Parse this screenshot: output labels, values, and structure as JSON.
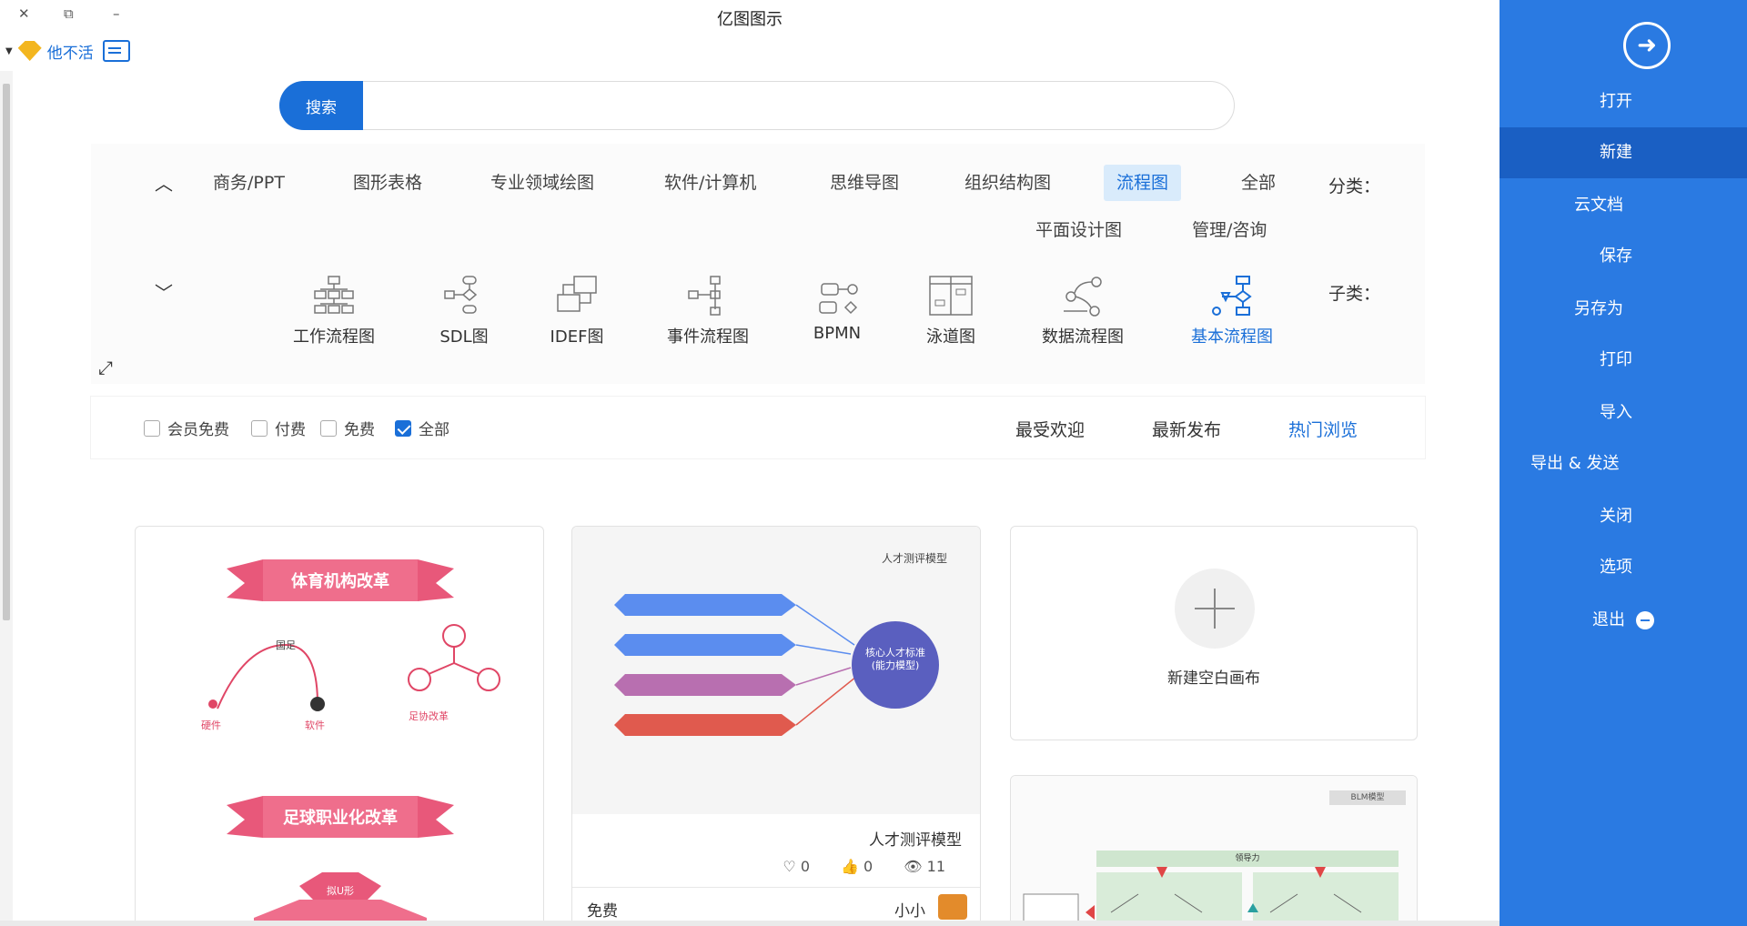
{
  "window": {
    "title": "亿图图示",
    "close": "✕",
    "restore": "⧉",
    "minimize": "–"
  },
  "user": {
    "name": "他不活"
  },
  "search": {
    "button": "搜索",
    "placeholder": ""
  },
  "sidebar": {
    "items": [
      {
        "label": "打开"
      },
      {
        "label": "新建"
      },
      {
        "label": "云文档"
      },
      {
        "label": "保存"
      },
      {
        "label": "另存为"
      },
      {
        "label": "打印"
      },
      {
        "label": "导入"
      },
      {
        "label": "导出 & 发送"
      },
      {
        "label": "关闭"
      },
      {
        "label": "选项"
      },
      {
        "label": "退出"
      }
    ],
    "active_index": 1
  },
  "categories": {
    "label": "分类：",
    "items": [
      {
        "label": "全部"
      },
      {
        "label": "流程图"
      },
      {
        "label": "组织结构图"
      },
      {
        "label": "思维导图"
      },
      {
        "label": "软件/计算机"
      },
      {
        "label": "专业领域绘图"
      },
      {
        "label": "图形表格"
      },
      {
        "label": "商务/PPT"
      },
      {
        "label": "管理/咨询"
      },
      {
        "label": "平面设计图"
      }
    ],
    "active": "流程图"
  },
  "subcategories": {
    "label": "子类：",
    "items": [
      {
        "label": "基本流程图",
        "icon": "basic-flowchart-icon"
      },
      {
        "label": "数据流程图",
        "icon": "data-flow-icon"
      },
      {
        "label": "泳道图",
        "icon": "swimlane-icon"
      },
      {
        "label": "BPMN",
        "icon": "bpmn-icon"
      },
      {
        "label": "事件流程图",
        "icon": "event-flow-icon"
      },
      {
        "label": "IDEF图",
        "icon": "idef-icon"
      },
      {
        "label": "SDL图",
        "icon": "sdl-icon"
      },
      {
        "label": "工作流程图",
        "icon": "workflow-icon"
      }
    ],
    "active": "基本流程图"
  },
  "filters": {
    "sort_tabs": [
      {
        "label": "热门浏览"
      },
      {
        "label": "最新发布"
      },
      {
        "label": "最受欢迎"
      }
    ],
    "active_sort": "热门浏览",
    "checkboxes": [
      {
        "label": "全部",
        "checked": true
      },
      {
        "label": "免费",
        "checked": false
      },
      {
        "label": "付费",
        "checked": false
      },
      {
        "label": "会员免费",
        "checked": false
      }
    ]
  },
  "cards": {
    "new_blank": {
      "label": "新建空白画布"
    },
    "template1": {
      "title": "人才测评模型",
      "views": "11",
      "likes": "0",
      "favorites": "0",
      "author": "小小",
      "price": "免费",
      "diagram_header": "人才测评模型",
      "center_text": "核心人才标准(能力模型)"
    },
    "template2": {
      "banner_top": "体育机构改革",
      "banner_mid": "足球职业化改革",
      "node_left": "国足",
      "node_right": "足协改革",
      "node_mid": "软件",
      "node_bottom": "硬件",
      "center": "拟U形"
    },
    "template3": {
      "tag": "BLM模型",
      "header": "领导力"
    }
  },
  "colors": {
    "accent": "#1a6fd8",
    "sidebar": "#2a7ae2",
    "sidebar_active": "#1a5fc3"
  }
}
